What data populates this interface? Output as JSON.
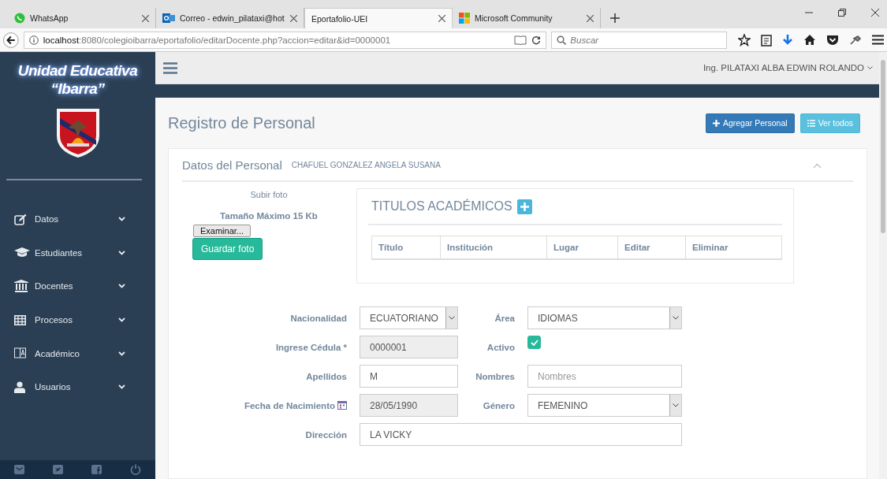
{
  "browser": {
    "tabs": [
      {
        "title": "WhatsApp",
        "selected": false
      },
      {
        "title": "Correo - edwin_pilataxi@hot",
        "selected": false
      },
      {
        "title": "Eportafolio-UEI",
        "selected": true
      },
      {
        "title": "Microsoft Community",
        "selected": false
      }
    ],
    "url_host": "localhost",
    "url_rest": ":8080/colegioibarra/eportafolio/editarDocente.php?accion=editar&id=0000001",
    "search_placeholder": "Buscar"
  },
  "sidebar": {
    "brand_line1": "Unidad Educativa",
    "brand_line2": "“Ibarra”",
    "items": [
      {
        "label": "Datos"
      },
      {
        "label": "Estudiantes"
      },
      {
        "label": "Docentes"
      },
      {
        "label": "Procesos"
      },
      {
        "label": "Académico"
      },
      {
        "label": "Usuarios"
      }
    ]
  },
  "topbar": {
    "user": "Ing. PILATAXI ALBA EDWIN ROLANDO"
  },
  "page": {
    "title": "Registro de Personal",
    "buttons": [
      {
        "label": "Agregar Personal",
        "kind": "primary"
      },
      {
        "label": "Ver todos",
        "kind": "info"
      }
    ],
    "panel": {
      "title": "Datos del Personal",
      "subtitle": "CHAFUEL GONZALEZ ANGELA SUSANA",
      "photo": {
        "label": "Subir foto",
        "size_note": "Tamaño Máximo 15 Kb",
        "file_button": "Examinar...",
        "save_button": "Guardar foto"
      },
      "titles": {
        "heading": "TITULOS ACADÉMICOS",
        "columns": [
          "Título",
          "Institución",
          "Lugar",
          "Editar",
          "Eliminar"
        ]
      },
      "form": [
        [
          {
            "label": "Nacionalidad",
            "kind": "select",
            "value": "ECUATORIANO",
            "disabled": false
          },
          {
            "label": "Área",
            "kind": "select",
            "value": "IDIOMAS",
            "disabled": false
          }
        ],
        [
          {
            "label": "Ingrese Cédula *",
            "kind": "text",
            "value": "0000001",
            "disabled": true
          },
          {
            "label": "Activo",
            "kind": "checkbox",
            "checked": true
          }
        ],
        [
          {
            "label": "Apellidos",
            "kind": "text",
            "value": "M",
            "disabled": false
          },
          {
            "label": "Nombres",
            "kind": "text",
            "placeholder": "Nombres",
            "disabled": false
          }
        ],
        [
          {
            "label": "Fecha de Nacimiento",
            "kind": "date",
            "value": "28/05/1990",
            "disabled": true
          },
          {
            "label": "Género",
            "kind": "select",
            "value": "FEMENINO",
            "disabled": false
          }
        ],
        [
          {
            "label": "Dirección",
            "kind": "wide",
            "value": "LA VICKY",
            "disabled": false
          }
        ]
      ]
    }
  }
}
